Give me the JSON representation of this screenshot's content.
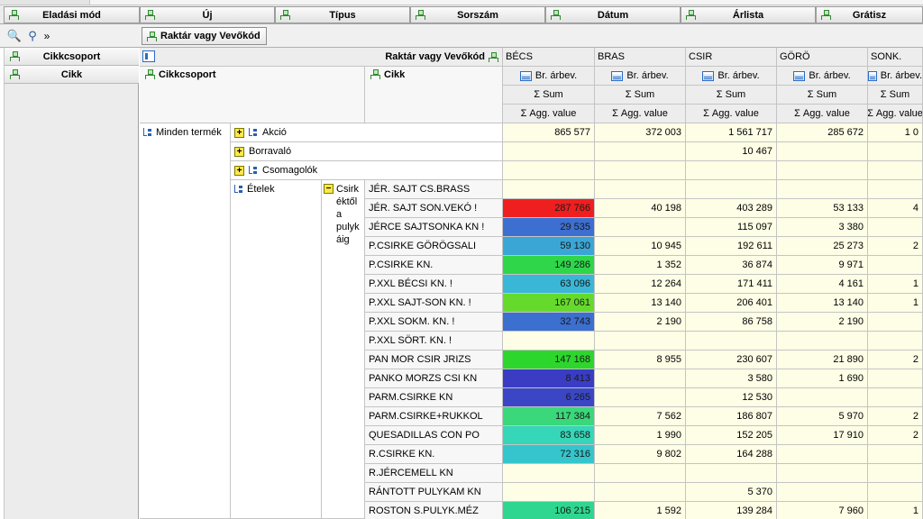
{
  "filter_fields": [
    "Eladási mód",
    "Új",
    "Típus",
    "Sorszám",
    "Dátum",
    "Árlista",
    "Grátisz"
  ],
  "column_field": "Raktár vagy Vevőkód",
  "row_fields": [
    "Cikkcsoport",
    "Cikk"
  ],
  "tools": {
    "zoom_icon": "magnifier-icon",
    "filter_icon": "funnel-icon",
    "more": "»"
  },
  "corner": {
    "field_label": "Raktár vagy Vevőkód"
  },
  "row_headers": {
    "group": "Cikkcsoport",
    "item": "Cikk"
  },
  "columns": [
    "BÉCS",
    "BRAS",
    "CSIR",
    "GÖRÖ",
    "SONK."
  ],
  "measure": {
    "label": "Br. árbev.",
    "sum": "Σ  Sum",
    "agg": "Σ  Agg. value"
  },
  "tree": {
    "root": "Minden termék",
    "groups": [
      {
        "label": "Akció",
        "expander": "+",
        "values": [
          "865 577",
          "372 003",
          "1 561 717",
          "285 672",
          "1 0"
        ]
      },
      {
        "label": "Borravaló",
        "expander": "+",
        "values": [
          "",
          "",
          "10 467",
          "",
          ""
        ]
      },
      {
        "label": "Csomagolók",
        "expander": "+",
        "values": [
          "",
          "",
          "",
          "",
          ""
        ]
      }
    ],
    "food": {
      "label": "Ételek",
      "sub_expander": "−",
      "sub_label_lines": [
        "Csirk",
        "éktől",
        "a",
        "pulyk",
        "áig"
      ]
    }
  },
  "items": [
    {
      "name": "JÉR. SAJT  CS.BRASS",
      "values": [
        "",
        "",
        "",
        "",
        ""
      ]
    },
    {
      "name": "JÉR. SAJT SON.VEKÓ !",
      "values": [
        "287 766",
        "40 198",
        "403 289",
        "53 133",
        "4"
      ]
    },
    {
      "name": "JÉRCE SAJTSONKA KN !",
      "values": [
        "29 535",
        "",
        "115 097",
        "3 380",
        ""
      ]
    },
    {
      "name": "P.CSIRKE GÖRÖGSALI",
      "values": [
        "59 130",
        "10 945",
        "192 611",
        "25 273",
        "2"
      ]
    },
    {
      "name": "P.CSIRKE KN.",
      "values": [
        "149 286",
        "1 352",
        "36 874",
        "9 971",
        ""
      ]
    },
    {
      "name": "P.XXL BÉCSI KN. !",
      "values": [
        "63 096",
        "12 264",
        "171 411",
        "4 161",
        "1"
      ]
    },
    {
      "name": "P.XXL SAJT-SON KN. !",
      "values": [
        "167 061",
        "13 140",
        "206 401",
        "13 140",
        "1"
      ]
    },
    {
      "name": "P.XXL SOKM. KN. !",
      "values": [
        "32 743",
        "2 190",
        "86 758",
        "2 190",
        ""
      ]
    },
    {
      "name": "P.XXL SÖRT. KN. !",
      "values": [
        "",
        "",
        "",
        "",
        ""
      ]
    },
    {
      "name": "PAN MOR CSIR JRIZS",
      "values": [
        "147 168",
        "8 955",
        "230 607",
        "21 890",
        "2"
      ]
    },
    {
      "name": "PANKO MORZS CSI KN",
      "values": [
        "8 413",
        "",
        "3 580",
        "1 690",
        ""
      ]
    },
    {
      "name": "PARM.CSIRKE KN",
      "values": [
        "6 265",
        "",
        "12 530",
        "",
        ""
      ]
    },
    {
      "name": "PARM.CSIRKE+RUKKOL",
      "values": [
        "117 384",
        "7 562",
        "186 807",
        "5 970",
        "2"
      ]
    },
    {
      "name": "QUESADILLAS CON PO",
      "values": [
        "83 658",
        "1 990",
        "152 205",
        "17 910",
        "2"
      ]
    },
    {
      "name": "R.CSIRKE KN.",
      "values": [
        "72 316",
        "9 802",
        "164 288",
        "",
        ""
      ]
    },
    {
      "name": "R.JÉRCEMELL KN",
      "values": [
        "",
        "",
        "",
        "",
        ""
      ]
    },
    {
      "name": "RÁNTOTT PULYKAM KN",
      "values": [
        "",
        "",
        "5 370",
        "",
        ""
      ]
    },
    {
      "name": "ROSTON S.PULYK.MÉZ",
      "values": [
        "106 215",
        "1 592",
        "139 284",
        "7 960",
        "1"
      ]
    }
  ],
  "heat_colors": [
    "",
    "#ef1f1f",
    "#3d6fd1",
    "#3aa6d6",
    "#2fd64a",
    "#3ab6d6",
    "#66da2c",
    "#3b6fd0",
    "",
    "#2cd62c",
    "#3a3dc4",
    "#3a46c6",
    "#3ad87a",
    "#36d6b8",
    "#34c6cc",
    "",
    "",
    "#2fd690"
  ]
}
